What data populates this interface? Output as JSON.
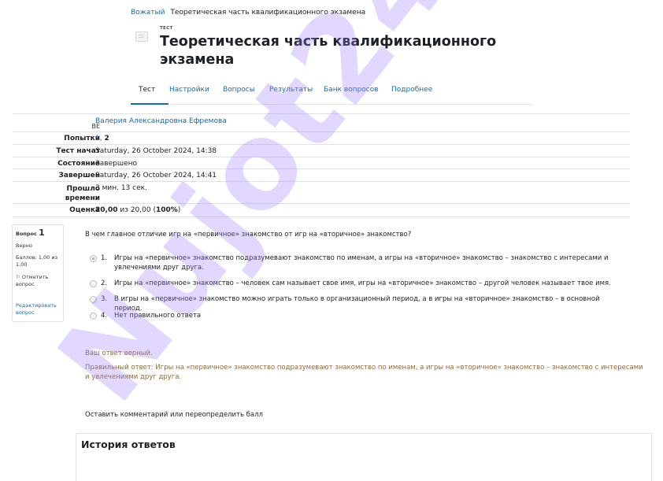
{
  "breadcrumb": {
    "link": "Вожатый",
    "current": "Теоретическая часть квалификационного экзамена"
  },
  "header": {
    "kicker": "ТЕСТ",
    "title": "Теоретическая часть квалификационного экзамена"
  },
  "tabs": [
    "Тест",
    "Настройки",
    "Вопросы",
    "Результаты",
    "Банк вопросов",
    "Подробнее"
  ],
  "summary": {
    "avatar_initials": "ВЕ",
    "user_name": "Валерия Александровна Ефремова",
    "attempts_label": "Попытки",
    "attempts_prefix": "1, ",
    "attempts_current": "2",
    "started_label": "Тест начат",
    "started_value": "Saturday, 26 October 2024, 14:38",
    "state_label": "Состояние",
    "state_value": "Завершено",
    "finished_label": "Завершен",
    "finished_value": "Saturday, 26 October 2024, 14:41",
    "time_label_1": "Прошло",
    "time_label_2": "времени",
    "time_value": "3 мин. 13 сек.",
    "grade_label": "Оценка",
    "grade_score": "20,00",
    "grade_mid": " из 20,00 (",
    "grade_pct": "100%",
    "grade_end": ")"
  },
  "question_info": {
    "label": "Вопрос",
    "number": "1",
    "state": "Верно",
    "grade": "Баллов: 1,00 из 1,00",
    "flag": "Отметить вопрос",
    "edit": "Редактировать вопрос"
  },
  "question": {
    "text": "В чем главное отличие игр на «первичное» знакомство от игр на «вторичное» знакомство?",
    "answers": [
      {
        "num": "1.",
        "text": "Игры на «первичное» знакомство подразумевают знакомство по именам, а игры на «вторичное» знакомство – знакомство с интересами и увлечениями друг друга."
      },
      {
        "num": "2.",
        "text": "Игры на «первичное» знакомство – человек сам называет свое имя, игры на «вторичное» знакомство – другой человек называет твое имя."
      },
      {
        "num": "3.",
        "text": "В игры на «первичное» знакомство можно играть только в организационный период, а в игры на «вторичное» знакомство – в основной период."
      },
      {
        "num": "4.",
        "text": "Нет правильного ответа"
      }
    ],
    "feedback": "Ваш ответ верный.",
    "right_answer": "Правильный ответ: Игры на «первичное» знакомство подразумевают знакомство по именам, а игры на «вторичное» знакомство – знакомство с интересами и увлечениями друг друга."
  },
  "comment_link": "Оставить комментарий или переопределить балл",
  "history_title": "История ответов",
  "watermark": {
    "text": "Nujot24",
    "color": "#9b7bff"
  },
  "colors": {
    "link": "#0f6cbf",
    "feedback": "#8a6d3b"
  }
}
